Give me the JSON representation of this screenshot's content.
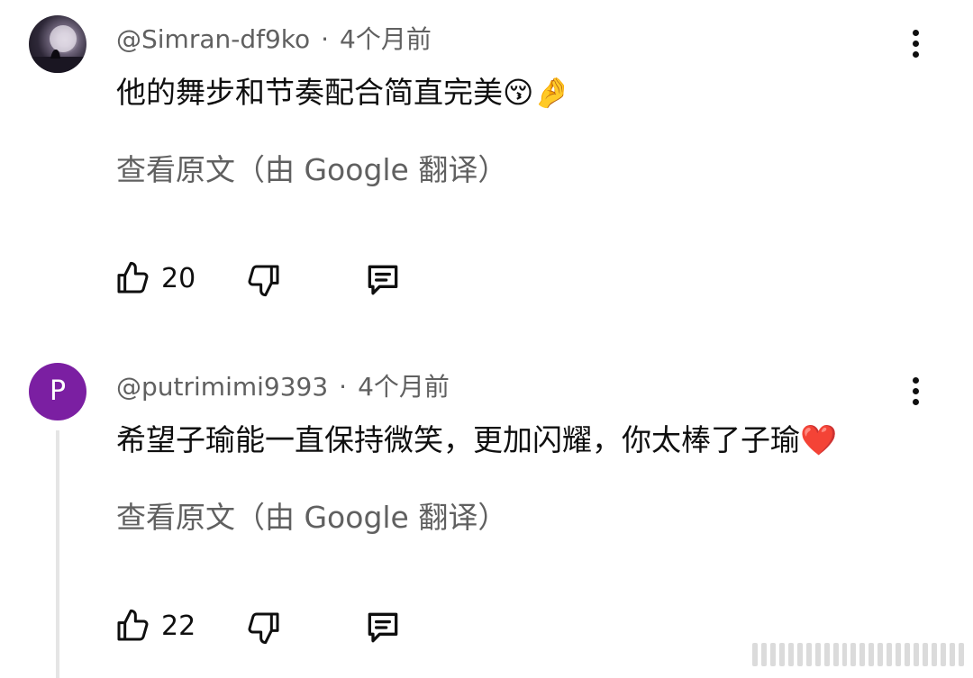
{
  "comments": [
    {
      "author": "@Simran-df9ko",
      "separator": "·",
      "time": "4个月前",
      "text": "他的舞步和节奏配合简直完美😚🤌",
      "translate_label": "查看原文（由 Google 翻译）",
      "likes": "20",
      "avatar_letter": ""
    },
    {
      "author": "@putrimimi9393",
      "separator": "·",
      "time": "4个月前",
      "text": "希望子瑜能一直保持微笑，更加闪耀，你太棒了子瑜❤️",
      "translate_label": "查看原文（由 Google 翻译）",
      "likes": "22",
      "avatar_letter": "P",
      "avatar_color": "#7b1fa2"
    }
  ],
  "icons": {
    "like": "thumbs-up-icon",
    "dislike": "thumbs-down-icon",
    "reply": "reply-comment-icon",
    "more": "more-vertical-icon"
  }
}
